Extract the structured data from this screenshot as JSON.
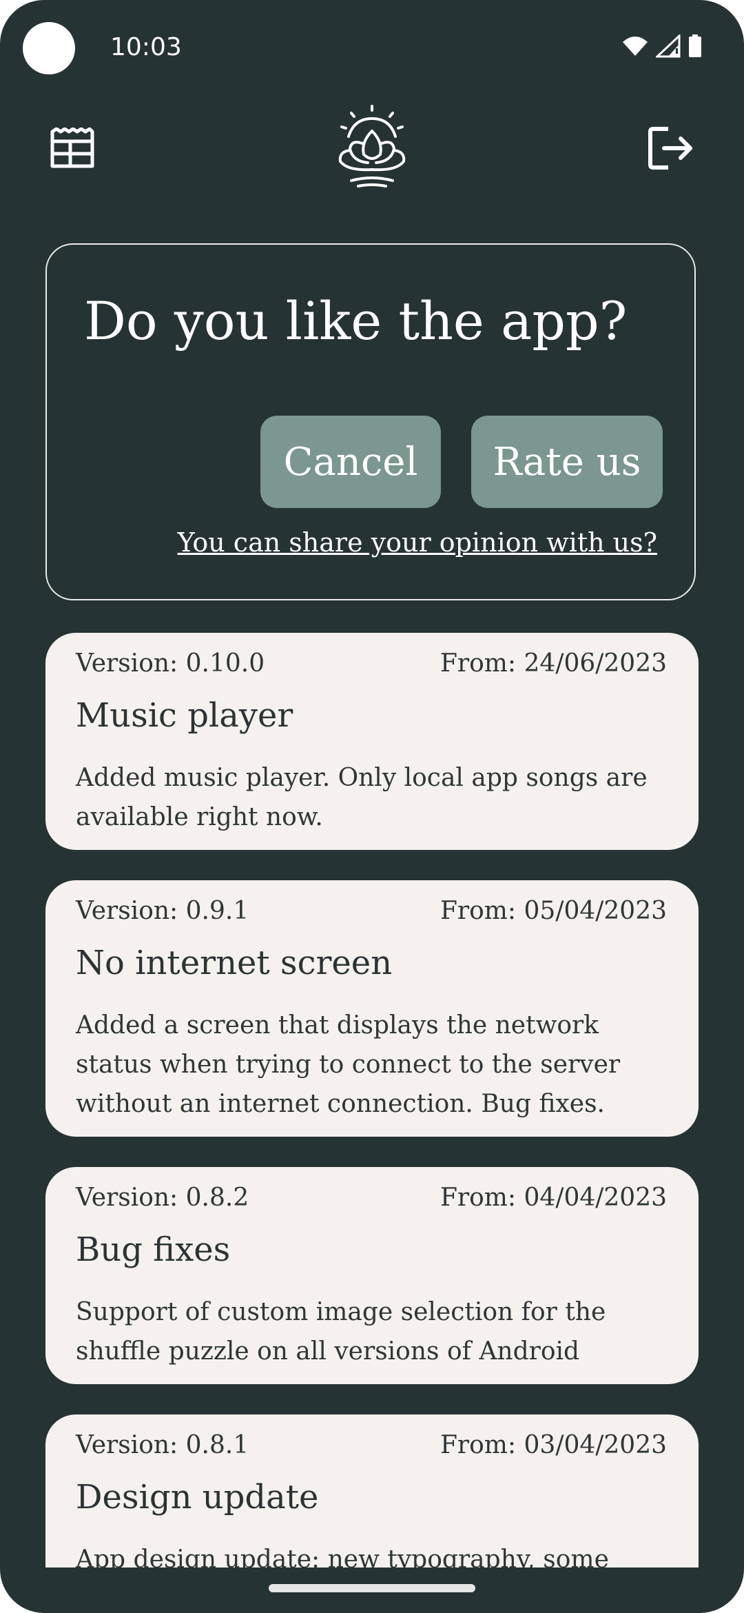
{
  "status_bar": {
    "time": "10:03",
    "icons": [
      "wifi-icon",
      "signal-icon",
      "battery-icon"
    ]
  },
  "top_bar": {
    "left_icon": "news-icon",
    "logo_icon": "lotus-icon",
    "right_icon": "logout-icon"
  },
  "rate_card": {
    "title": "Do you like the app?",
    "cancel_label": "Cancel",
    "rate_label": "Rate us",
    "share_link": "You can share your opinion with us?"
  },
  "changelog": [
    {
      "version": "Version: 0.10.0",
      "date": "From: 24/06/2023",
      "title": "Music player",
      "description": "Added music player. Only local app songs are available right now."
    },
    {
      "version": "Version: 0.9.1",
      "date": "From: 05/04/2023",
      "title": "No internet screen",
      "description": "Added a screen that displays the network status when trying to connect to the server without an internet connection. Bug fixes."
    },
    {
      "version": "Version: 0.8.2",
      "date": "From: 04/04/2023",
      "title": "Bug fixes",
      "description": "Support of custom image selection for the shuffle puzzle on all versions of Android"
    },
    {
      "version": "Version: 0.8.1",
      "date": "From: 03/04/2023",
      "title": "Design update",
      "description": "App design update: new typography, some color"
    }
  ],
  "colors": {
    "background": "#263333",
    "button": "#7b978f",
    "card": "#f4f1ee"
  }
}
